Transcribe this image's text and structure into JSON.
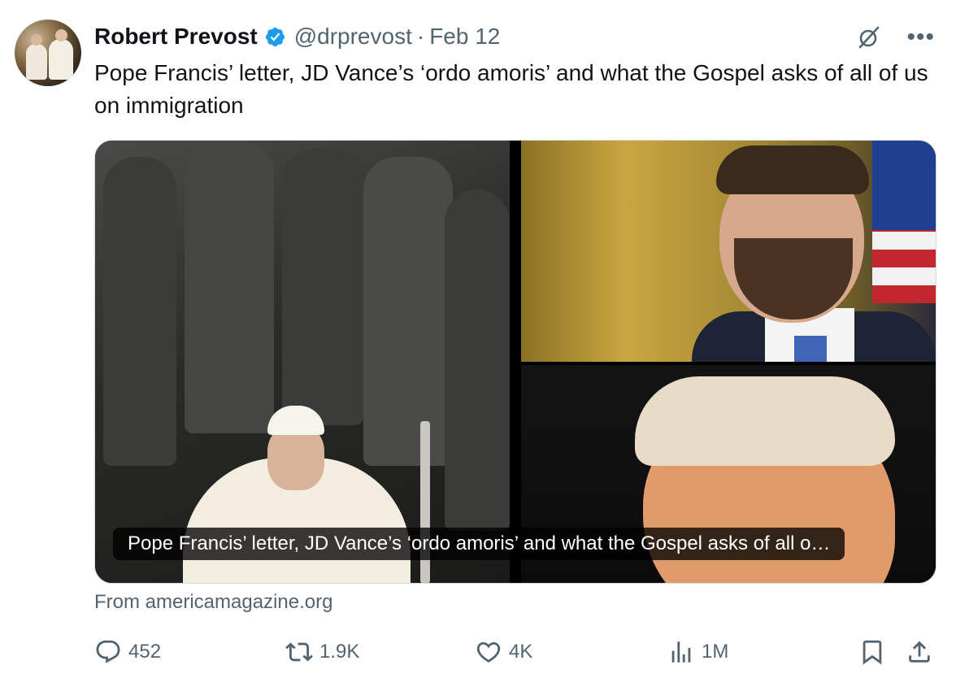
{
  "author": {
    "name": "Robert Prevost",
    "handle": "@drprevost",
    "separator": "·",
    "date": "Feb 12"
  },
  "tweet": {
    "text": "Pope Francis’ letter, JD Vance’s ‘ordo amoris’ and what the Gospel asks of all of us on immigration"
  },
  "card": {
    "caption": "Pope Francis’ letter, JD Vance’s ‘ordo amoris’ and what the Gospel asks of all o…",
    "source": "From americamagazine.org"
  },
  "actions": {
    "replies": "452",
    "reposts": "1.9K",
    "likes": "4K",
    "views": "1M"
  },
  "icons": {
    "verified": "verified-badge-icon",
    "grok": "grok-icon",
    "more": "more-icon",
    "reply": "reply-icon",
    "repost": "repost-icon",
    "like": "heart-icon",
    "views": "views-icon",
    "bookmark": "bookmark-icon",
    "share": "share-icon"
  },
  "colors": {
    "text": "#0f1419",
    "secondary": "#536471",
    "verified": "#1d9bf0",
    "border": "#cfd9de"
  }
}
